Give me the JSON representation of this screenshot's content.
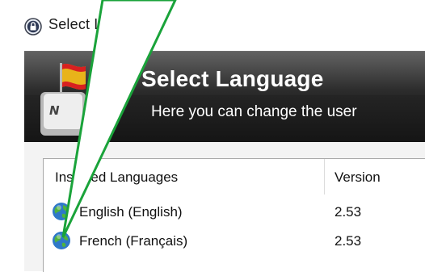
{
  "window": {
    "title": "Select Language",
    "icon": "lock-icon"
  },
  "banner": {
    "title": "Select Language",
    "subtitle": "Here you can change the user",
    "icon": "keyboard-flag-icon"
  },
  "list": {
    "columns": [
      "Installed Languages",
      "Version"
    ],
    "rows": [
      {
        "name": "English (English)",
        "version": "2.53",
        "icon": "globe-icon"
      },
      {
        "name": "French (Français)",
        "version": "2.53",
        "icon": "globe-icon"
      }
    ]
  },
  "colors": {
    "banner_dark": "#1a1a1a",
    "callout_border": "#1aa33a",
    "callout_fill": "#ffffff"
  }
}
